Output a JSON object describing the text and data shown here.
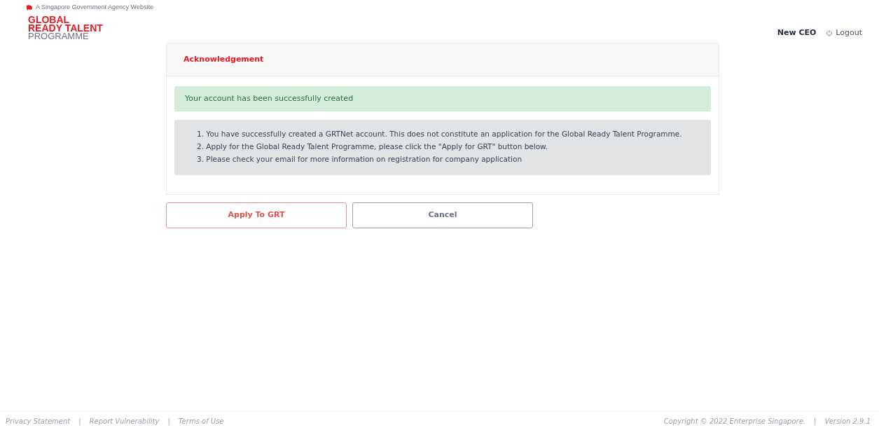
{
  "gov_banner": "A Singapore Government Agency Website",
  "logo": {
    "line_1": "GLOBAL",
    "line_2": "READY TALENT",
    "line_3": "PROGRAMME"
  },
  "user": {
    "name": "New CEO",
    "logout": "Logout"
  },
  "card": {
    "title": "Acknowledgement",
    "alert": "Your account has been successfully created",
    "notes": [
      "1. You have successfully created a GRTNet account. This does not constitute an application for the Global Ready Talent Programme.",
      "2. Apply for the Global Ready Talent Programme, please click the \"Apply for GRT\" button below.",
      "3. Please check your email for more information on registration for company application"
    ]
  },
  "buttons": [
    {
      "kind": "primary",
      "label": "Apply To GRT"
    },
    {
      "kind": "secondary",
      "label": "Cancel"
    }
  ],
  "footer": {
    "left": [
      {
        "kind": "link",
        "text": "Privacy Statement"
      },
      {
        "kind": "separator",
        "text": "|"
      },
      {
        "kind": "link",
        "text": "Report Vulnerability"
      },
      {
        "kind": "separator",
        "text": "|"
      },
      {
        "kind": "link",
        "text": "Terms of Use"
      }
    ],
    "right": [
      {
        "kind": "text",
        "text": "Copyright © 2022 Enterprise Singapore."
      },
      {
        "kind": "separator",
        "text": "|"
      },
      {
        "kind": "text",
        "text": "Version 2.9.1"
      }
    ]
  }
}
